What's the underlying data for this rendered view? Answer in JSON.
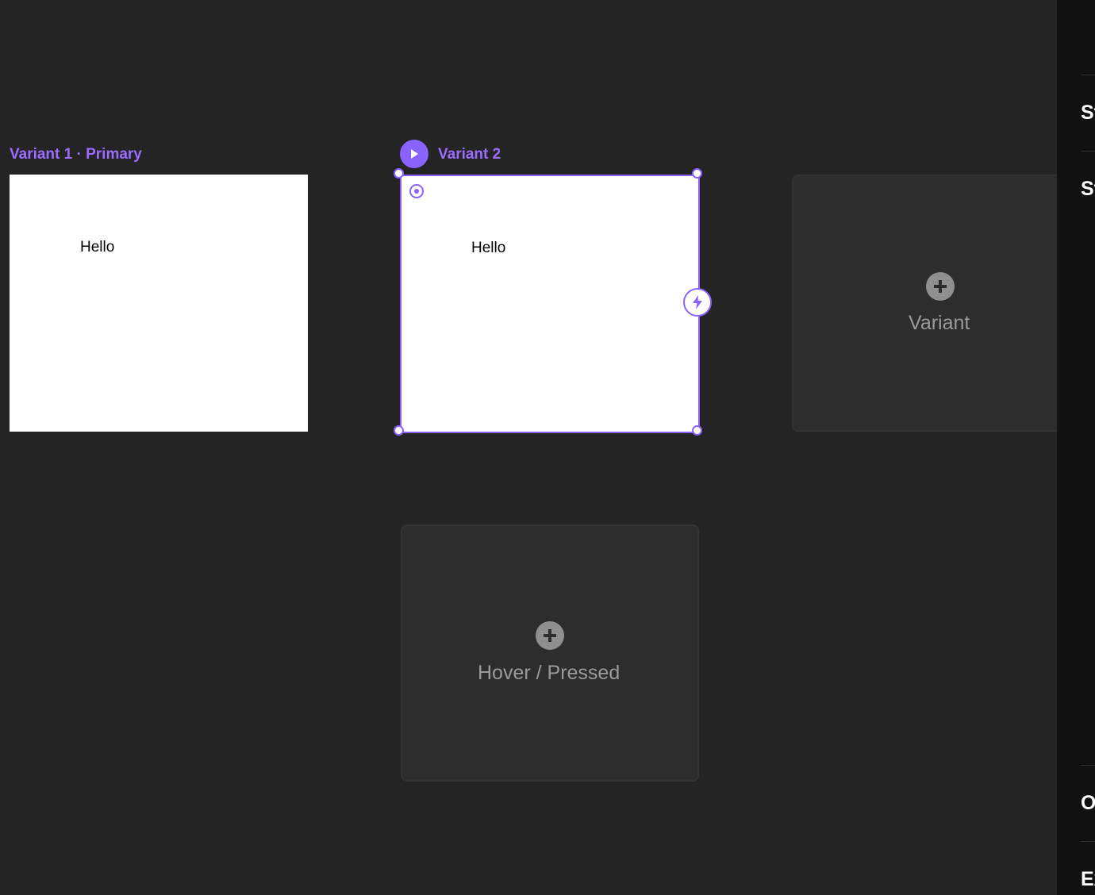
{
  "canvas": {
    "variant1": {
      "label": "Variant 1 · Primary",
      "text": "Hello"
    },
    "variant2": {
      "label": "Variant 2",
      "text": "Hello",
      "selected": true
    },
    "add_variant": {
      "label": "Variant",
      "icon": "plus-circle-icon"
    },
    "add_state": {
      "label": "Hover / Pressed",
      "icon": "plus-circle-icon"
    }
  },
  "side_panel": {
    "sections": [
      "St",
      "St",
      "O",
      "Ex"
    ]
  },
  "colors": {
    "canvas_bg": "#242424",
    "accent": "#8a63ff",
    "label_accent": "#9b6cff",
    "placeholder_bg": "#2d2d2d",
    "panel_bg": "#111111"
  }
}
